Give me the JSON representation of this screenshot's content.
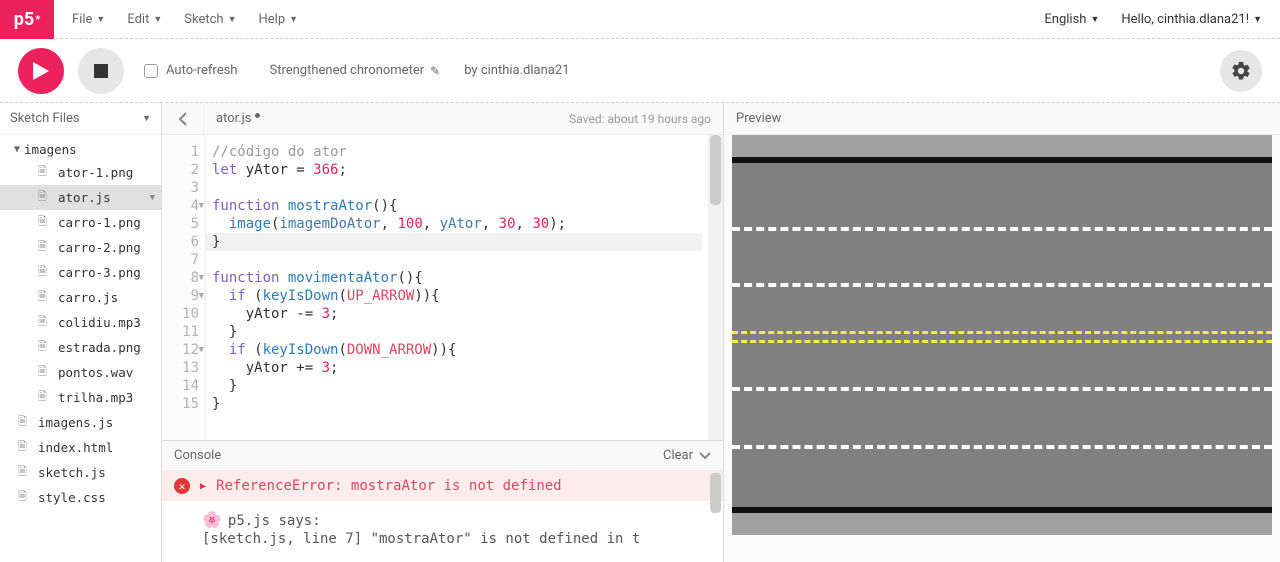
{
  "topbar": {
    "logo": "p5",
    "logo_sup": "*",
    "menu": [
      "File",
      "Edit",
      "Sketch",
      "Help"
    ],
    "language": "English",
    "greeting": "Hello, cinthia.dlana21!"
  },
  "toolbar": {
    "auto_refresh": "Auto-refresh",
    "sketch_name": "Strengthened chronometer",
    "author_prefix": "by",
    "author": "cinthia.dlana21"
  },
  "sidebar": {
    "title": "Sketch Files",
    "tree": {
      "folder": "imagens",
      "children": [
        "ator-1.png",
        "ator.js",
        "carro-1.png",
        "carro-2.png",
        "carro-3.png",
        "carro.js",
        "colidiu.mp3",
        "estrada.png",
        "pontos.wav",
        "trilha.mp3"
      ],
      "root_files": [
        "imagens.js",
        "index.html",
        "sketch.js",
        "style.css"
      ],
      "selected": "ator.js"
    }
  },
  "editor": {
    "filename": "ator.js",
    "saved": "Saved: about 19 hours ago",
    "lines": [
      {
        "n": 1,
        "html": "<span class='cm-comment'>//código do ator</span>"
      },
      {
        "n": 2,
        "html": "<span class='cm-keyword'>let</span> yAtor = <span class='cm-num'>366</span>;"
      },
      {
        "n": 3,
        "html": ""
      },
      {
        "n": 4,
        "fold": true,
        "html": "<span class='cm-keyword'>function</span> <span class='cm-fn'>mostraAtor</span>(){"
      },
      {
        "n": 5,
        "html": "  <span class='cm-fn'>image</span>(<span class='cm-var'>imagemDoAtor</span>, <span class='cm-num'>100</span>, <span class='cm-var'>yAtor</span>, <span class='cm-num'>30</span>, <span class='cm-num'>30</span>);"
      },
      {
        "n": 6,
        "hl": true,
        "html": "}"
      },
      {
        "n": 7,
        "html": ""
      },
      {
        "n": 8,
        "fold": true,
        "html": "<span class='cm-keyword'>function</span> <span class='cm-fn'>movimentaAtor</span>(){"
      },
      {
        "n": 9,
        "fold": true,
        "html": "  <span class='cm-keyword'>if</span> (<span class='cm-fn'>keyIsDown</span>(<span class='cm-const'>UP_ARROW</span>)){"
      },
      {
        "n": 10,
        "html": "    yAtor -= <span class='cm-num'>3</span>;"
      },
      {
        "n": 11,
        "html": "  }"
      },
      {
        "n": 12,
        "fold": true,
        "html": "  <span class='cm-keyword'>if</span> (<span class='cm-fn'>keyIsDown</span>(<span class='cm-const'>DOWN_ARROW</span>)){"
      },
      {
        "n": 13,
        "html": "    yAtor += <span class='cm-num'>3</span>;"
      },
      {
        "n": 14,
        "html": "  }"
      },
      {
        "n": 15,
        "html": "}"
      }
    ]
  },
  "console": {
    "title": "Console",
    "clear": "Clear",
    "error": "ReferenceError: mostraAtor is not defined",
    "info_line1": "p5.js says:",
    "info_line2": "[sketch.js, line 7] \"mostraAtor\" is not defined in t"
  },
  "preview": {
    "title": "Preview"
  }
}
